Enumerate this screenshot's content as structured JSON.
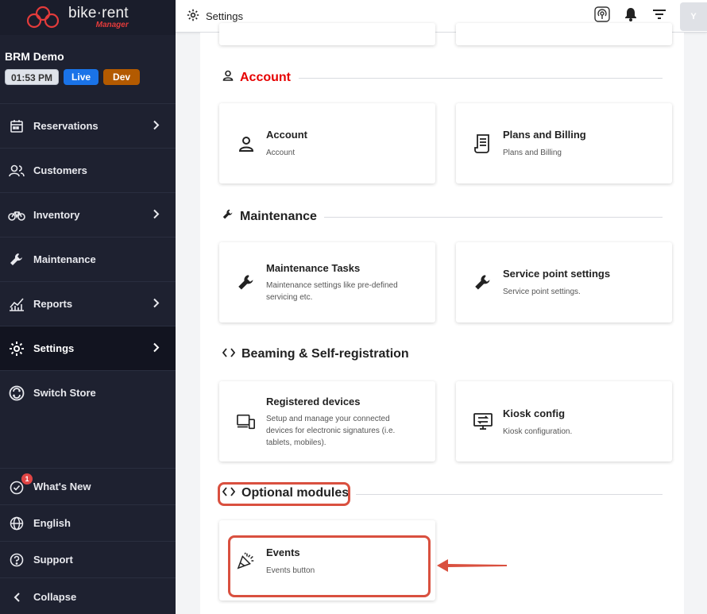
{
  "brand": {
    "name": "bike·rent",
    "subtitle": "Manager"
  },
  "store": {
    "name": "BRM Demo",
    "time": "01:53 PM",
    "live": "Live",
    "dev": "Dev"
  },
  "sidebar": {
    "items": [
      {
        "label": "Reservations",
        "icon": "calendar-icon"
      },
      {
        "label": "Customers",
        "icon": "users-icon"
      },
      {
        "label": "Inventory",
        "icon": "bike-icon"
      },
      {
        "label": "Maintenance",
        "icon": "wrench-icon"
      },
      {
        "label": "Reports",
        "icon": "chart-icon"
      },
      {
        "label": "Settings",
        "icon": "gear-icon"
      },
      {
        "label": "Switch Store",
        "icon": "switch-icon"
      }
    ],
    "bottom": {
      "whats_new": "What's New",
      "whats_new_count": "1",
      "language": "English",
      "support": "Support",
      "collapse": "Collapse"
    }
  },
  "topbar": {
    "title": "Settings",
    "avatar": "Y"
  },
  "sections": {
    "account": {
      "title": "Account",
      "title_color": "#e60000"
    },
    "maintenance": {
      "title": "Maintenance"
    },
    "beaming": {
      "title": "Beaming & Self-registration"
    },
    "optional": {
      "title": "Optional modules"
    }
  },
  "cards": {
    "account": {
      "title": "Account",
      "desc": "Account"
    },
    "plans": {
      "title": "Plans and Billing",
      "desc": "Plans and Billing"
    },
    "maint_tasks": {
      "title": "Maintenance Tasks",
      "desc": "Maintenance settings like pre-defined servicing etc."
    },
    "service_point": {
      "title": "Service point settings",
      "desc": "Service point settings."
    },
    "registered": {
      "title": "Registered devices",
      "desc": "Setup and manage your connected devices for electronic signatures (i.e. tablets, mobiles)."
    },
    "kiosk": {
      "title": "Kiosk config",
      "desc": "Kiosk configuration."
    },
    "events": {
      "title": "Events",
      "desc": "Events button"
    }
  },
  "colors": {
    "highlight": "#d9503f",
    "sidebar_bg": "#1e2130",
    "accent_red": "#e60000"
  }
}
